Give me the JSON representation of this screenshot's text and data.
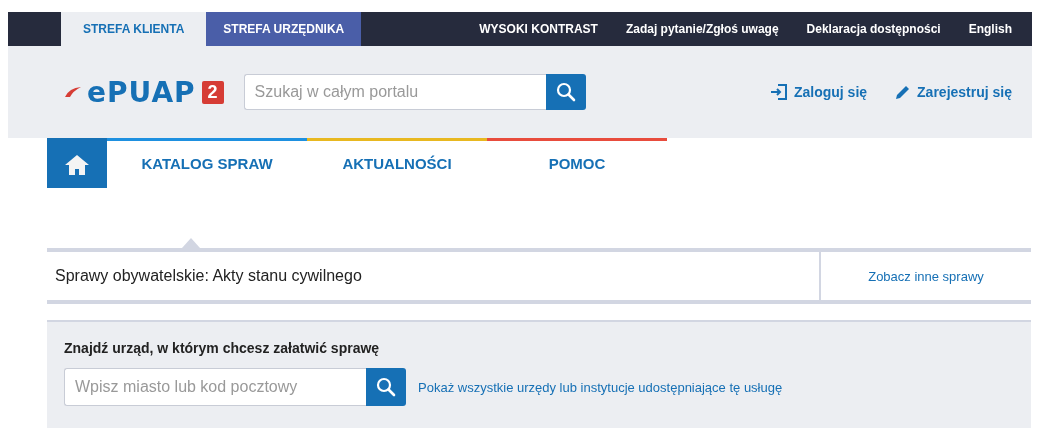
{
  "top_bar": {
    "zones": [
      {
        "label": "STREFA KLIENTA",
        "selected": true
      },
      {
        "label": "STREFA URZĘDNIKA",
        "selected": false
      }
    ],
    "links": [
      "WYSOKI KONTRAST",
      "Zadaj pytanie/Zgłoś uwagę",
      "Deklaracja dostępności",
      "English"
    ]
  },
  "header": {
    "logo": {
      "text": "ePUAP",
      "badge": "2"
    },
    "search": {
      "placeholder": "Szukaj w całym portalu"
    },
    "login": "Zaloguj się",
    "register": "Zarejestruj się"
  },
  "nav": {
    "items": [
      {
        "label": "KATALOG SPRAW",
        "color": "#1e90e0"
      },
      {
        "label": "AKTUALNOŚCI",
        "color": "#e8b820"
      },
      {
        "label": "POMOC",
        "color": "#e84c3d"
      }
    ]
  },
  "breadcrumb": {
    "title": "Sprawy obywatelskie: Akty stanu cywilnego",
    "link": "Zobacz inne sprawy"
  },
  "office_search": {
    "heading": "Znajdź urząd, w którym chcesz załatwić sprawę",
    "placeholder": "Wpisz miasto lub kod pocztowy",
    "link": "Pokaż wszystkie urzędy lub instytucje udostępniające tę usługę"
  }
}
